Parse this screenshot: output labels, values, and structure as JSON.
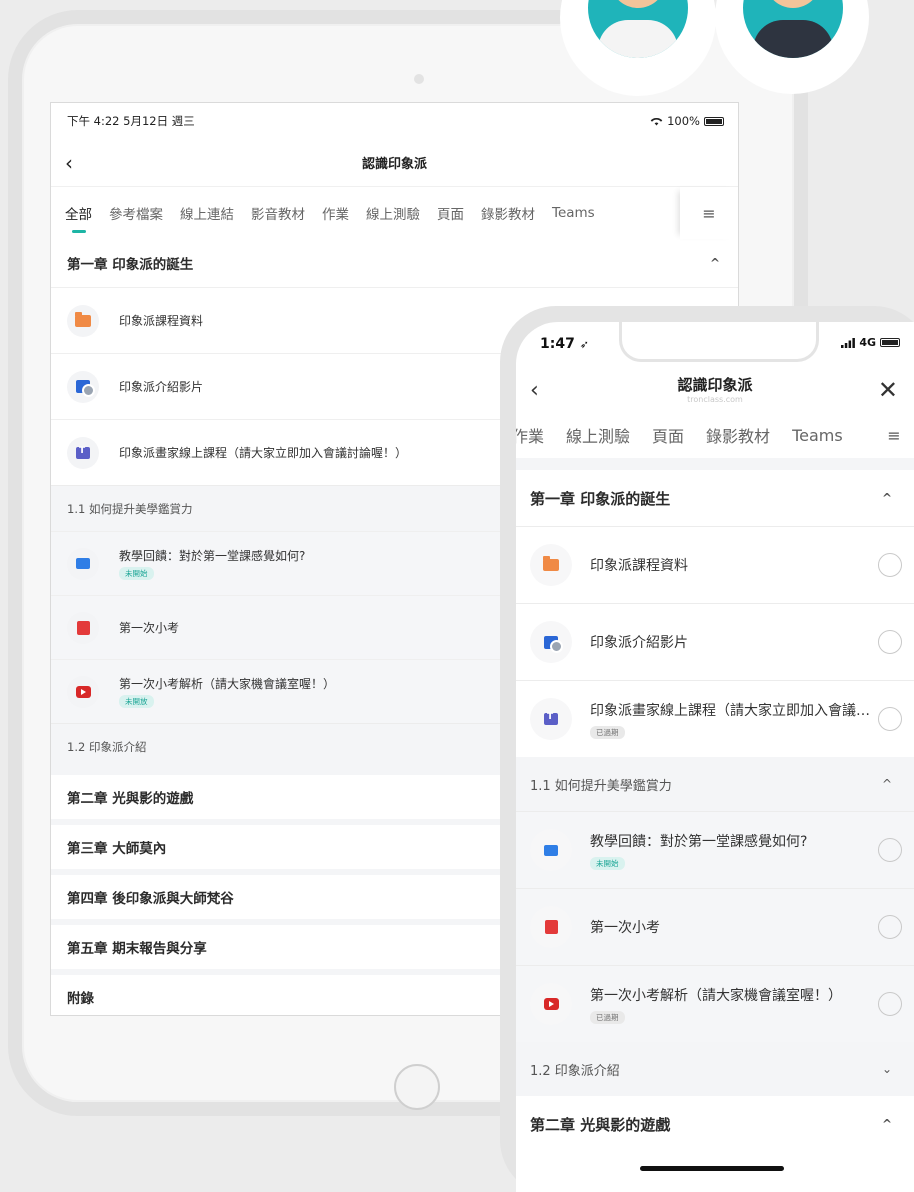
{
  "tablet": {
    "status": {
      "time": "下午 4:22  5月12日 週三",
      "battery": "100%",
      "wifi_icon": "wifi-icon"
    },
    "nav": {
      "back": "‹",
      "title": "認識印象派"
    },
    "tabs": [
      "全部",
      "參考檔案",
      "線上連結",
      "影音教材",
      "作業",
      "線上測驗",
      "頁面",
      "錄影教材",
      "Teams"
    ],
    "tabs_menu": "≡",
    "chapter1": {
      "title": "第一章 印象派的誕生",
      "caret": "^"
    },
    "items": [
      {
        "label": "印象派課程資料",
        "icon": "folder-icon"
      },
      {
        "label": "印象派介紹影片",
        "icon": "video-icon"
      },
      {
        "label": "印象派畫家線上課程（請大家立即加入會議討論喔！）",
        "icon": "teams-icon"
      }
    ],
    "section1": "1.1 如何提升美學鑑賞力",
    "section_items": [
      {
        "label": "教學回饋：對於第一堂課感覺如何?",
        "badge": "未開始",
        "icon": "feedback-icon"
      },
      {
        "label": "第一次小考",
        "badge": "",
        "icon": "exam-icon"
      },
      {
        "label": "第一次小考解析（請大家機會議室喔！）",
        "badge": "未開放",
        "icon": "play-icon"
      }
    ],
    "section2": "1.2 印象派介紹",
    "chapters": [
      "第二章 光與影的遊戲",
      "第三章 大師莫內",
      "第四章 後印象派與大師梵谷",
      "第五章 期末報告與分享",
      "附錄"
    ]
  },
  "phone": {
    "status": {
      "time": "1:47",
      "network": "4G"
    },
    "nav": {
      "back": "‹",
      "title": "認識印象派",
      "domain": "tronclass.com",
      "close": "✕"
    },
    "tabs": [
      "作業",
      "線上測驗",
      "頁面",
      "錄影教材",
      "Teams"
    ],
    "tabs_menu": "≡",
    "chapter1": {
      "title": "第一章 印象派的誕生",
      "caret": "^"
    },
    "items": [
      {
        "label": "印象派課程資料",
        "badge": "",
        "icon": "folder-icon"
      },
      {
        "label": "印象派介紹影片",
        "badge": "",
        "icon": "video-icon"
      },
      {
        "label": "印象派畫家線上課程（請大家立即加入會議討論喔！）",
        "badge": "已過期",
        "icon": "teams-icon"
      }
    ],
    "section1": {
      "label": "1.1 如何提升美學鑑賞力",
      "caret": "^"
    },
    "section_items": [
      {
        "label": "教學回饋：對於第一堂課感覺如何?",
        "badge": "未開始",
        "icon": "feedback-icon"
      },
      {
        "label": "第一次小考",
        "badge": "",
        "icon": "exam-icon"
      },
      {
        "label": "第一次小考解析（請大家機會議室喔！）",
        "badge": "已過期",
        "icon": "play-icon"
      }
    ],
    "section2": {
      "label": "1.2 印象派介紹",
      "caret": "⌄"
    },
    "chapter2": {
      "title": "第二章 光與影的遊戲",
      "caret": "^"
    }
  },
  "colors": {
    "accent": "#1db5a5",
    "avatar_bg": "#1fb4ba"
  }
}
